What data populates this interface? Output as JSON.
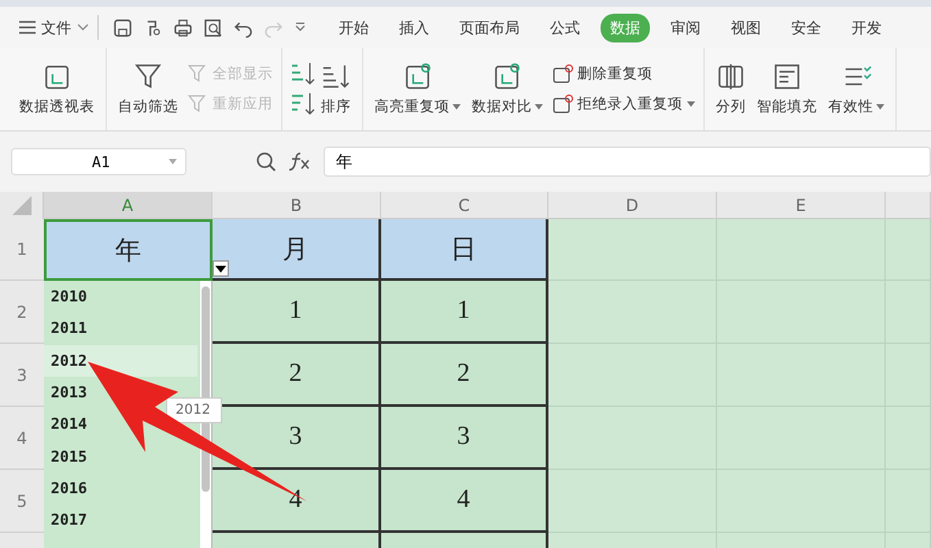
{
  "menu_bar": {
    "file_menu": "文件",
    "tabs": [
      {
        "label": "开始",
        "selected": false
      },
      {
        "label": "插入",
        "selected": false
      },
      {
        "label": "页面布局",
        "selected": false
      },
      {
        "label": "公式",
        "selected": false
      },
      {
        "label": "数据",
        "selected": true
      },
      {
        "label": "审阅",
        "selected": false
      },
      {
        "label": "视图",
        "selected": false
      },
      {
        "label": "安全",
        "selected": false
      },
      {
        "label": "开发",
        "selected": false
      }
    ]
  },
  "ribbon": {
    "groups": [
      {
        "items": [
          {
            "kind": "large",
            "label": "数据透视表",
            "dropdown": false
          }
        ]
      },
      {
        "items": [
          {
            "kind": "large",
            "label": "自动筛选",
            "dropdown": false
          },
          {
            "kind": "stack",
            "children": [
              {
                "label": "全部显示",
                "disabled": true
              },
              {
                "label": "重新应用",
                "disabled": true
              }
            ]
          }
        ]
      },
      {
        "items": [
          {
            "kind": "sort",
            "label": "排序"
          }
        ]
      },
      {
        "items": [
          {
            "kind": "large",
            "label": "高亮重复项",
            "dropdown": true
          },
          {
            "kind": "large",
            "label": "数据对比",
            "dropdown": true
          },
          {
            "kind": "stack",
            "children": [
              {
                "label": "删除重复项",
                "disabled": false,
                "dropdown": false
              },
              {
                "label": "拒绝录入重复项",
                "disabled": false,
                "dropdown": true
              }
            ]
          }
        ]
      },
      {
        "items": [
          {
            "kind": "large",
            "label": "分列",
            "dropdown": false
          },
          {
            "kind": "large",
            "label": "智能填充",
            "dropdown": false
          },
          {
            "kind": "large",
            "label": "有效性",
            "dropdown": true
          }
        ]
      }
    ]
  },
  "formula_bar": {
    "name_box": "A1",
    "formula": "年"
  },
  "sheet": {
    "columns": [
      {
        "label": "A",
        "selected": true
      },
      {
        "label": "B",
        "selected": false
      },
      {
        "label": "C",
        "selected": false
      },
      {
        "label": "D",
        "selected": false
      },
      {
        "label": "E",
        "selected": false
      }
    ],
    "rows": [
      {
        "label": "1",
        "header": true,
        "cells": [
          "年",
          "月",
          "日"
        ]
      },
      {
        "label": "2",
        "header": false,
        "cells": [
          null,
          "1",
          "1"
        ]
      },
      {
        "label": "3",
        "header": false,
        "cells": [
          null,
          "2",
          "2"
        ]
      },
      {
        "label": "4",
        "header": false,
        "cells": [
          null,
          "3",
          "3"
        ]
      },
      {
        "label": "5",
        "header": false,
        "cells": [
          null,
          "4",
          "4"
        ]
      }
    ]
  },
  "dropdown_list": {
    "items": [
      {
        "label": "2010",
        "selected": false
      },
      {
        "label": "2011",
        "selected": false
      },
      {
        "label": "2012",
        "selected": true
      },
      {
        "label": "2013",
        "selected": false
      },
      {
        "label": "2014",
        "selected": false
      },
      {
        "label": "2015",
        "selected": false
      },
      {
        "label": "2016",
        "selected": false
      },
      {
        "label": "2017",
        "selected": false
      }
    ],
    "tooltip": "2012"
  }
}
